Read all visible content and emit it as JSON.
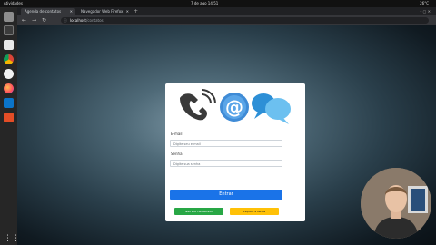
{
  "system": {
    "activities": "Atividades",
    "clock": "7 de ago  14:51",
    "status": "26°C"
  },
  "browser": {
    "tabs": [
      {
        "label": "Agenda de contatos"
      },
      {
        "label": "Navegador Web Firefox"
      }
    ],
    "url_host": "localhost",
    "url_path": "/contatos"
  },
  "login": {
    "email_label": "E-mail",
    "email_placeholder": "Digite seu e-mail",
    "password_label": "Senha",
    "password_placeholder": "Digite sua senha",
    "submit_label": "Entrar",
    "register_label": "Não sou cadastrado",
    "forgot_label": "Esqueci a senha"
  },
  "colors": {
    "primary": "#1a73e8",
    "success": "#28a745",
    "warning": "#ffc107"
  },
  "icons": [
    "phone-icon",
    "at-sign-icon",
    "chat-bubbles-icon"
  ]
}
